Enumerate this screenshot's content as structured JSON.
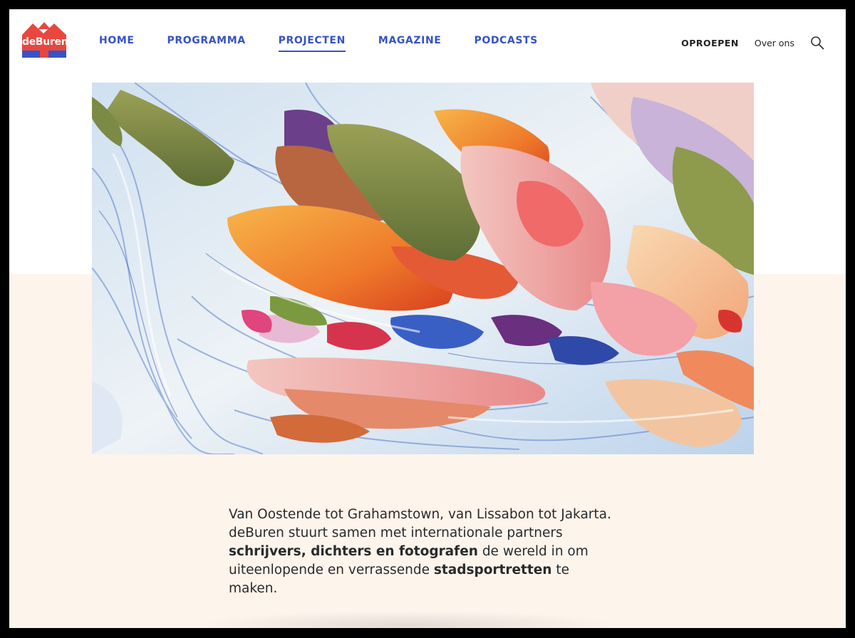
{
  "brand": {
    "name": "deBuren",
    "colors": {
      "red": "#e8473f",
      "blue": "#3552c8"
    }
  },
  "nav": {
    "items": [
      {
        "label": "HOME",
        "active": false
      },
      {
        "label": "PROGRAMMA",
        "active": false
      },
      {
        "label": "PROJECTEN",
        "active": true
      },
      {
        "label": "MAGAZINE",
        "active": false
      },
      {
        "label": "PODCASTS",
        "active": false
      }
    ]
  },
  "topright": {
    "oproepen": "OPROEPEN",
    "overons": "Over ons",
    "search_icon": "search-icon"
  },
  "intro": {
    "part1": "Van Oostende tot Grahamstown, van Lissabon tot Jakarta. deBuren stuurt samen met internationale partners ",
    "bold1": "schrijvers, dichters en fotografen",
    "part2": " de wereld in om uiteenlopende en verrassende ",
    "bold2": "stadsportretten",
    "part3": " te maken."
  }
}
